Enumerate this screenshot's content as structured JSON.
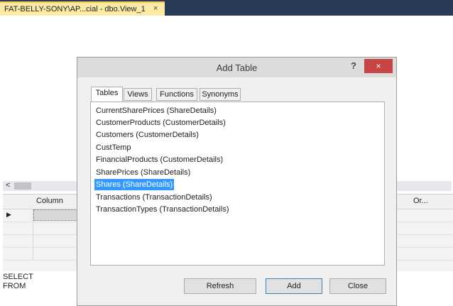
{
  "document_tab": {
    "title": "FAT-BELLY-SONY\\AP...cial - dbo.View_1",
    "close_glyph": "×"
  },
  "grid": {
    "scroll_left_glyph": "<",
    "columns": [
      "Column",
      "Or..."
    ],
    "row_marker": "▶"
  },
  "sql": {
    "lines": [
      "SELECT",
      "FROM"
    ]
  },
  "dialog": {
    "title": "Add Table",
    "help_glyph": "?",
    "close_glyph": "×",
    "tabs": [
      "Tables",
      "Views",
      "Functions",
      "Synonyms"
    ],
    "active_tab": "Tables",
    "items": [
      "CurrentSharePrices (ShareDetails)",
      "CustomerProducts (CustomerDetails)",
      "Customers (CustomerDetails)",
      "CustTemp",
      "FinancialProducts (CustomerDetails)",
      "SharePrices (ShareDetails)",
      "Shares (ShareDetails)",
      "Transactions (TransactionDetails)",
      "TransactionTypes (TransactionDetails)"
    ],
    "selected_item": "Shares (ShareDetails)",
    "buttons": {
      "refresh": "Refresh",
      "add": "Add",
      "close": "Close"
    }
  },
  "colors": {
    "tabstrip_bg": "#2b3a57",
    "doc_tab_bg": "#fbe9a6",
    "selection": "#3399ff",
    "close_button": "#c74545"
  }
}
